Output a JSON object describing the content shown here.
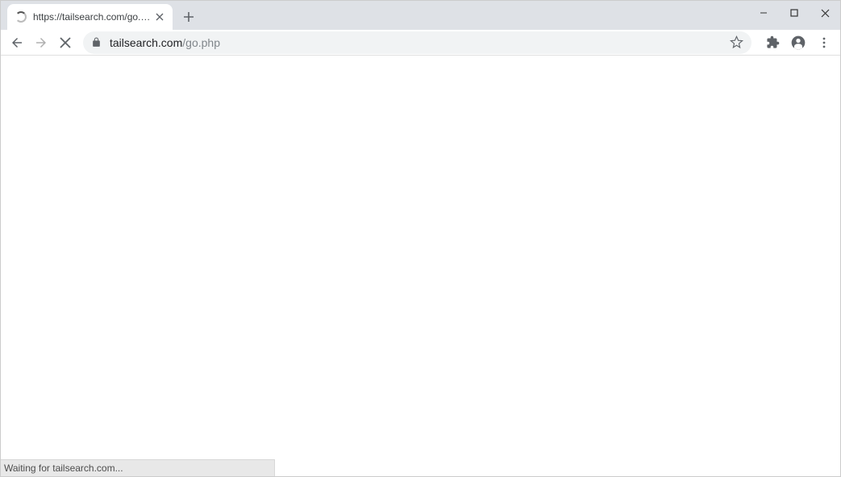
{
  "tab": {
    "title": "https://tailsearch.com/go.php"
  },
  "address": {
    "domain": "tailsearch.com",
    "path": "/go.php"
  },
  "status": {
    "text": "Waiting for tailsearch.com..."
  }
}
